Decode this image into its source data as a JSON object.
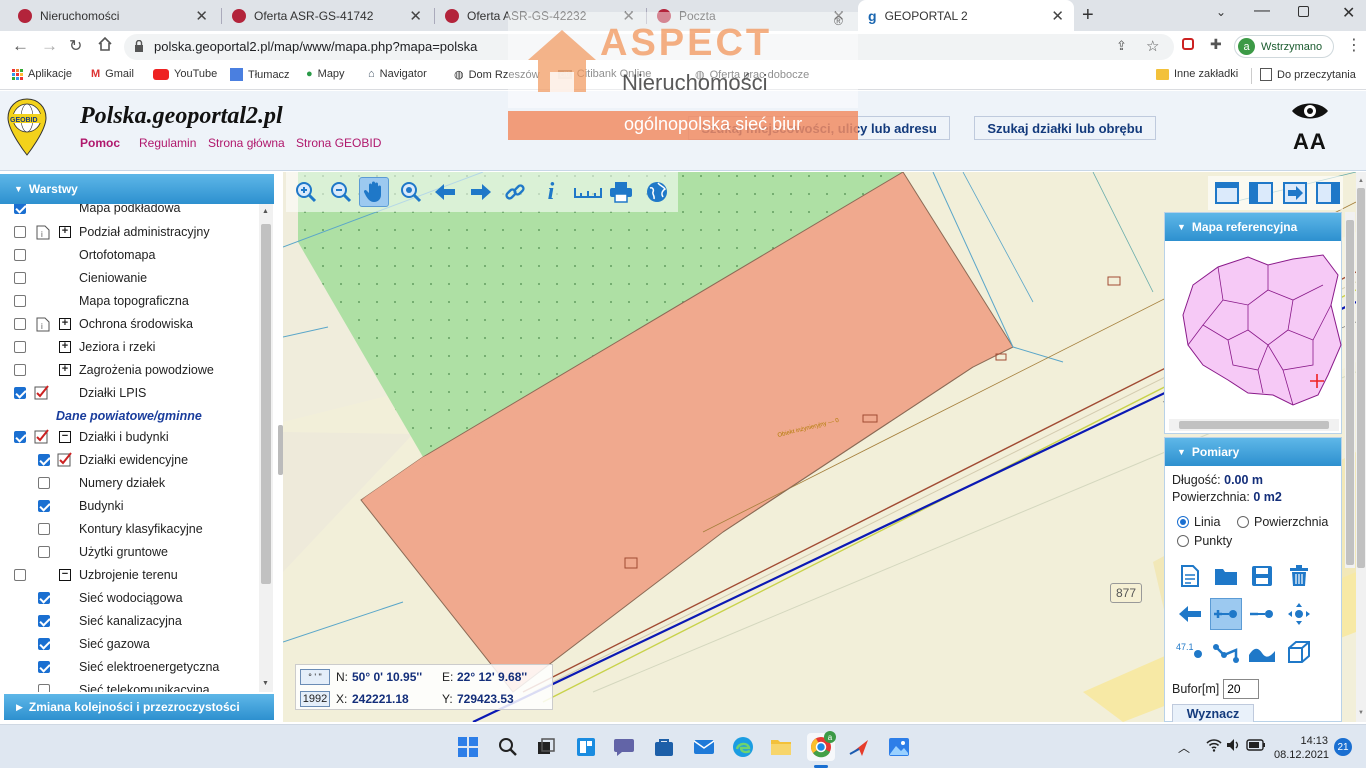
{
  "browser": {
    "tabs": [
      {
        "title": "Nieruchomości"
      },
      {
        "title": "Oferta ASR-GS-41742"
      },
      {
        "title": "Oferta ASR-GS-42232"
      },
      {
        "title": "Poczta"
      },
      {
        "title": "GEOPORTAL 2"
      }
    ],
    "url": "polska.geoportal2.pl/map/www/mapa.php?mapa=polska",
    "profile_label": "Wstrzymano",
    "profile_initial": "a",
    "new_tab": "+",
    "bookmarks": [
      "Aplikacje",
      "Gmail",
      "YouTube",
      "Tłumacz",
      "Mapy",
      "Navigator",
      "Dom Rzeszów",
      "Citibank Online",
      "Oferta prac dobocze"
    ],
    "bookmark_folders": [
      "Inne zakładki",
      "Do przeczytania"
    ]
  },
  "watermark": {
    "brand": "ASPECT",
    "line1": "Nieruchomości",
    "line2": "ogólnopolska sieć biur",
    "reg": "®"
  },
  "site": {
    "logo_text": "GEOBID",
    "title": "Polska.geoportal2.pl",
    "links": [
      "Pomoc",
      "Regulamin",
      "Strona główna",
      "Strona GEOBID"
    ],
    "search_place_button": "Szukaj miejscowości, ulicy lub adresu",
    "search_parcel_button": "Szukaj działki lub obrębu",
    "font_size_toggle": "AA"
  },
  "layers_panel": {
    "header": "Warstwy",
    "section_label": "Dane powiatowe/gminne",
    "layers": [
      {
        "label": "Mapa podkładowa",
        "checked": true
      },
      {
        "label": "Podział administracyjny",
        "checked": false
      },
      {
        "label": "Ortofotomapa",
        "checked": false
      },
      {
        "label": "Cieniowanie",
        "checked": false
      },
      {
        "label": "Mapa topograficzna",
        "checked": false
      },
      {
        "label": "Ochrona środowiska",
        "checked": false
      },
      {
        "label": "Jeziora i rzeki",
        "checked": false
      },
      {
        "label": "Zagrożenia powodziowe",
        "checked": false
      },
      {
        "label": "Działki LPIS",
        "checked": true
      },
      {
        "label": "Działki i budynki",
        "checked": true
      },
      {
        "label": "Działki ewidencyjne",
        "checked": true
      },
      {
        "label": "Numery działek",
        "checked": false
      },
      {
        "label": "Budynki",
        "checked": true
      },
      {
        "label": "Kontury klasyfikacyjne",
        "checked": false
      },
      {
        "label": "Użytki gruntowe",
        "checked": false
      },
      {
        "label": "Uzbrojenie terenu",
        "checked": false
      },
      {
        "label": "Sieć wodociągowa",
        "checked": true
      },
      {
        "label": "Sieć kanalizacyjna",
        "checked": true
      },
      {
        "label": "Sieć gazowa",
        "checked": true
      },
      {
        "label": "Sieć elektroenergetyczna",
        "checked": true
      },
      {
        "label": "Sieć telekomunikacyjna",
        "checked": false
      }
    ],
    "footer": "Zmiana kolejności i przezroczystości"
  },
  "map": {
    "road_number": "877",
    "coordinates": {
      "mode_label": "° ' \"",
      "system_label": "1992",
      "n_label": "N:",
      "n_value": "50° 0' 10.95''",
      "e_label": "E:",
      "e_value": "22° 12' 9.68''",
      "x_label": "X:",
      "x_value": "242221.18",
      "y_label": "Y:",
      "y_value": "729423.53"
    }
  },
  "reference_map": {
    "header": "Mapa referencyjna"
  },
  "measure": {
    "header": "Pomiary",
    "length_label": "Długość:",
    "length_value": "0.00 m",
    "area_label": "Powierzchnia:",
    "area_value": "0 m2",
    "modes": [
      "Linia",
      "Powierzchnia",
      "Punkty"
    ],
    "selected_mode": "Linia",
    "buffer_label": "Bufor[m]",
    "buffer_value": "20",
    "compute_button": "Wyznacz",
    "label_tool": "47.1"
  },
  "taskbar": {
    "time": "14:13",
    "date": "08.12.2021",
    "notifications": "21",
    "chrome_badge": "a"
  },
  "colors": {
    "panel_header": "#2d90cf",
    "link": "#b0186d",
    "parcel_fill": "#f0a98e",
    "grass_fill": "#aee0a4",
    "title_color": "#111111"
  }
}
